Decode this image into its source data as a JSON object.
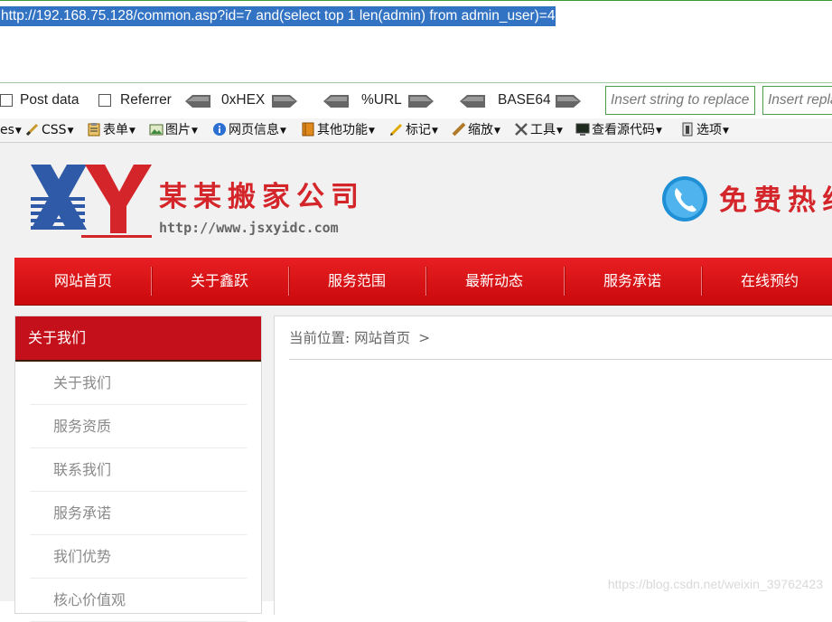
{
  "hackbar": {
    "url": "http://192.168.75.128/common.asp?id=7 and(select top 1 len(admin) from admin_user)=4",
    "post_data_label": "Post data",
    "referrer_label": "Referrer",
    "hex_label": "0xHEX",
    "url_label": "%URL",
    "base64_label": "BASE64",
    "replace_placeholder": "Insert string to replace",
    "replacement_placeholder": "Insert replacing string"
  },
  "webdev_toolbar": {
    "items": [
      "es",
      "CSS",
      "表单",
      "图片",
      "网页信息",
      "其他功能",
      "标记",
      "缩放",
      "工具",
      "查看源代码",
      "选项"
    ]
  },
  "site": {
    "company_name": "某某搬家公司",
    "company_url": "http://www.jsxyidc.com",
    "hotline_text": "免费热线",
    "nav": [
      "网站首页",
      "关于鑫跃",
      "服务范围",
      "最新动态",
      "服务承诺",
      "在线预约"
    ],
    "sidebar_title": "关于我们",
    "sidebar_items": [
      "关于我们",
      "服务资质",
      "联系我们",
      "服务承诺",
      "我们优势",
      "核心价值观"
    ],
    "breadcrumb_label": "当前位置:",
    "breadcrumb_home": "网站首页",
    "breadcrumb_sep": ">",
    "watermark": "https://blog.csdn.net/weixin_39762423"
  },
  "colors": {
    "brand_red": "#d4262a",
    "nav_red": "#e81f22",
    "hackbar_green": "#4aa04a",
    "selection_blue": "#3373c4"
  }
}
